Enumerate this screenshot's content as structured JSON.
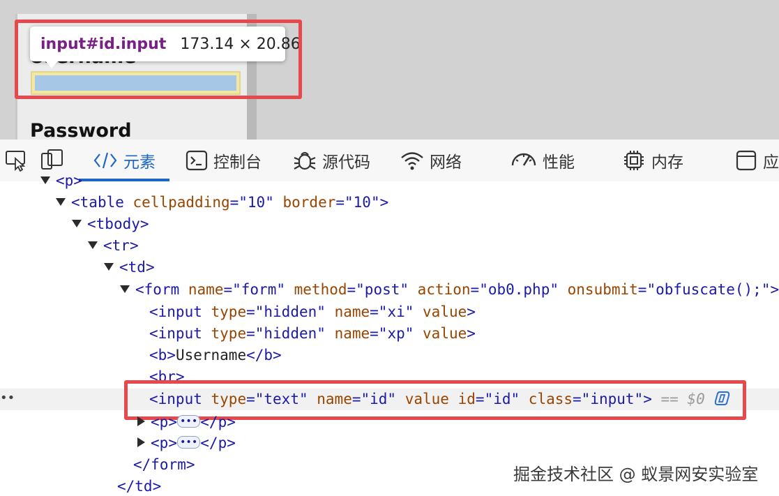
{
  "preview": {
    "username_label": "Username",
    "password_label": "Password",
    "tooltip": {
      "selector": "input#id.input",
      "dimensions": "173.14 × 20.86"
    }
  },
  "devtools": {
    "tabs": [
      {
        "label": "元素",
        "icon": "code-icon"
      },
      {
        "label": "控制台",
        "icon": "console-icon"
      },
      {
        "label": "源代码",
        "icon": "bug-icon"
      },
      {
        "label": "网络",
        "icon": "wifi-icon"
      },
      {
        "label": "性能",
        "icon": "gauge-icon"
      },
      {
        "label": "内存",
        "icon": "chip-icon"
      },
      {
        "label": "应",
        "icon": "panel-icon"
      }
    ],
    "active_tab": "元素",
    "accent_color": "#1f66c2"
  },
  "dom": {
    "p_open": "<p>",
    "table": {
      "tag": "table",
      "attrs": [
        {
          "name": "cellpadding",
          "value": "\"10\""
        },
        {
          "name": "border",
          "value": "\"10\""
        }
      ]
    },
    "tbody": "tbody",
    "tr": "tr",
    "td": "td",
    "form": {
      "tag": "form",
      "attrs": [
        {
          "name": "name",
          "value": "\"form\""
        },
        {
          "name": "method",
          "value": "\"post\""
        },
        {
          "name": "action",
          "value": "\"ob0.php\""
        },
        {
          "name": "onsubmit",
          "value": "\"obfuscate();\""
        }
      ]
    },
    "hidden1": {
      "type": "\"hidden\"",
      "name": "\"xi\"",
      "value": "value"
    },
    "hidden2": {
      "type": "\"hidden\"",
      "name": "\"xp\"",
      "value": "value"
    },
    "b_text": "Username",
    "br": "br",
    "selected_input": {
      "type": "\"text\"",
      "name": "\"id\"",
      "value": "value",
      "id": "\"id\"",
      "class": "\"input\"",
      "marker": "== $0"
    },
    "p_collapsed": "p",
    "ellipsis": "•••",
    "form_close": "</form>",
    "td_close": "</td>"
  },
  "watermark": "掘金技术社区 @ 蚁景网安实验室"
}
